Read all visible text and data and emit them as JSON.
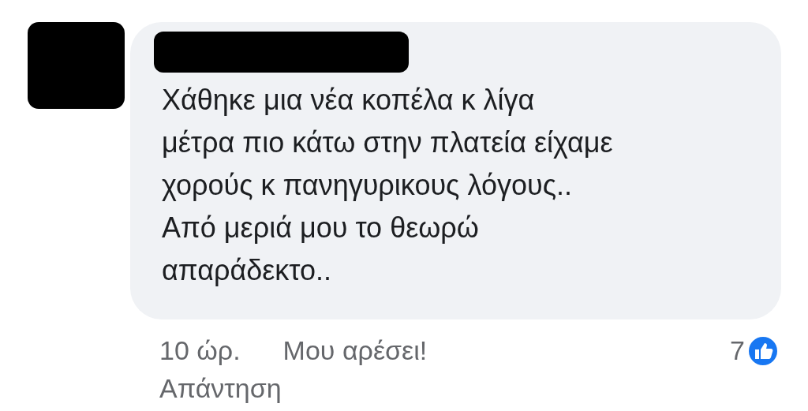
{
  "comment": {
    "text_lines": [
      "Χάθηκε μια νέα κοπέλα κ λίγα",
      "μέτρα πιο κάτω στην πλατεία είχαμε",
      "χορούς κ πανηγυρικους λόγους..",
      "Από μεριά μου το θεωρώ",
      "απαράδεκτο.."
    ],
    "time": "10 ώρ.",
    "like_action": "Μου αρέσει!",
    "reaction_count": "7",
    "reply_action": "Απάντηση"
  }
}
